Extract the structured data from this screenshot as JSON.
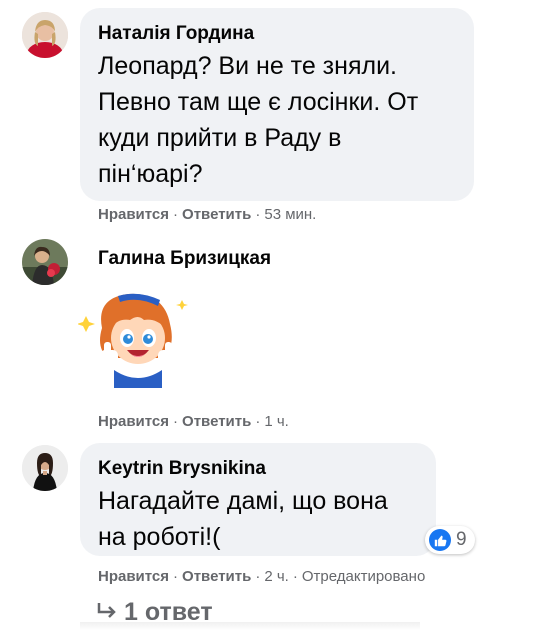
{
  "comments": [
    {
      "author": "Наталія Гордина",
      "lines": [
        "Леопард? Ви не те зняли.",
        "Певно там ще є лосінки. От",
        "куди прийти в Раду в",
        "пін‘юарі?"
      ],
      "actions": {
        "like": "Нравится",
        "reply": "Ответить",
        "time": "53 мин."
      }
    },
    {
      "author": "Галина Бризицкая",
      "sticker": "thumbs-up-girl-sticker",
      "actions": {
        "like": "Нравится",
        "reply": "Ответить",
        "time": "1 ч."
      }
    },
    {
      "author": "Keytrin Brysnikina",
      "lines": [
        "Нагадайте дамі, що вона",
        "на роботі!("
      ],
      "reaction": {
        "icon": "like-icon",
        "count": "9"
      },
      "actions": {
        "like": "Нравится",
        "reply": "Ответить",
        "time": "2 ч.",
        "edited": "Отредактировано"
      },
      "replies": "1 ответ"
    }
  ],
  "colors": {
    "bubble": "#f0f2f5",
    "meta": "#65676b",
    "like": "#1877f2"
  }
}
